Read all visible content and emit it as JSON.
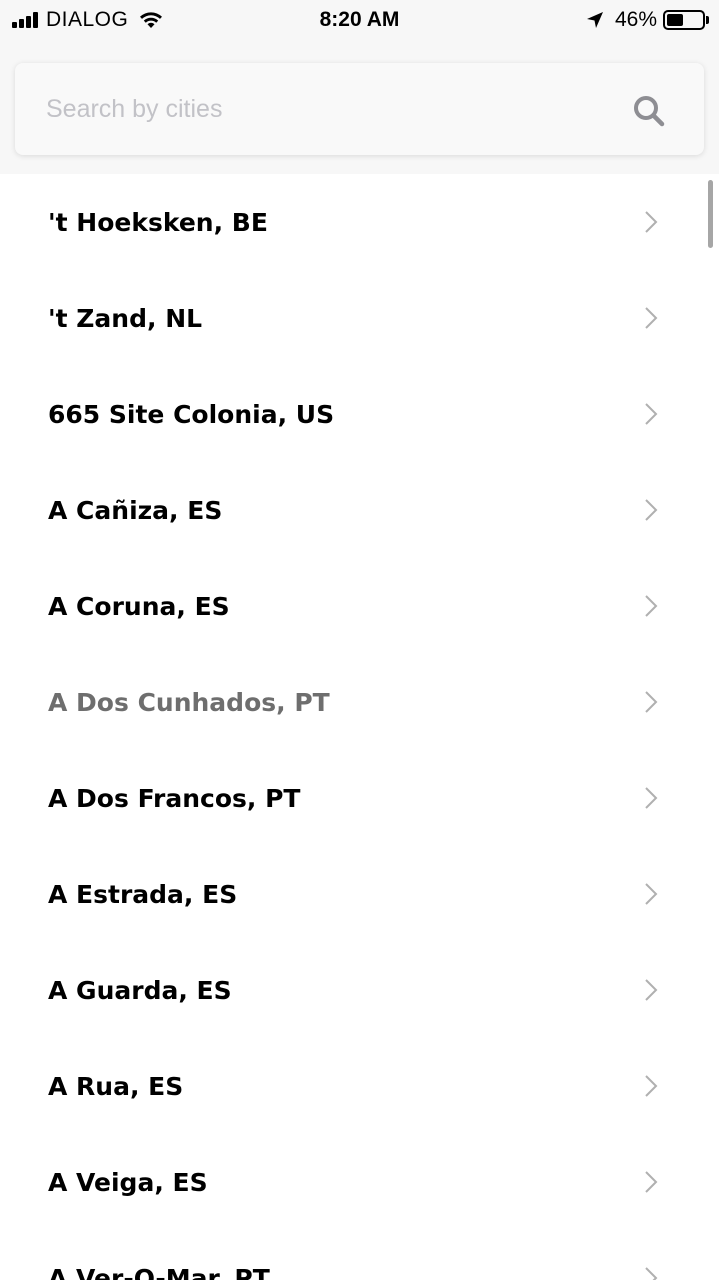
{
  "status_bar": {
    "carrier": "DIALOG",
    "time": "8:20 AM",
    "battery_percent": "46%",
    "battery_level": 0.46,
    "icons": [
      "signal-icon",
      "wifi-icon",
      "location-arrow-icon",
      "battery-icon"
    ]
  },
  "search": {
    "placeholder": "Search by cities",
    "value": "",
    "icon": "search-icon"
  },
  "cities": [
    {
      "label": "'t Hoeksken, BE",
      "dimmed": false
    },
    {
      "label": "'t Zand, NL",
      "dimmed": false
    },
    {
      "label": "665 Site Colonia, US",
      "dimmed": false
    },
    {
      "label": "A Cañiza, ES",
      "dimmed": false
    },
    {
      "label": "A Coruna, ES",
      "dimmed": false
    },
    {
      "label": "A Dos Cunhados, PT",
      "dimmed": true
    },
    {
      "label": "A Dos Francos, PT",
      "dimmed": false
    },
    {
      "label": "A Estrada, ES",
      "dimmed": false
    },
    {
      "label": "A Guarda, ES",
      "dimmed": false
    },
    {
      "label": "A Rua, ES",
      "dimmed": false
    },
    {
      "label": "A Veiga, ES",
      "dimmed": false
    },
    {
      "label": "A Ver-O-Mar, PT",
      "dimmed": false
    }
  ],
  "colors": {
    "text": "#000000",
    "dimmed_text": "#6e6e6e",
    "placeholder": "#c2c2c7",
    "chevron": "#b0b0b0",
    "search_icon": "#8e8e93",
    "header_background": "#f7f7f7"
  }
}
